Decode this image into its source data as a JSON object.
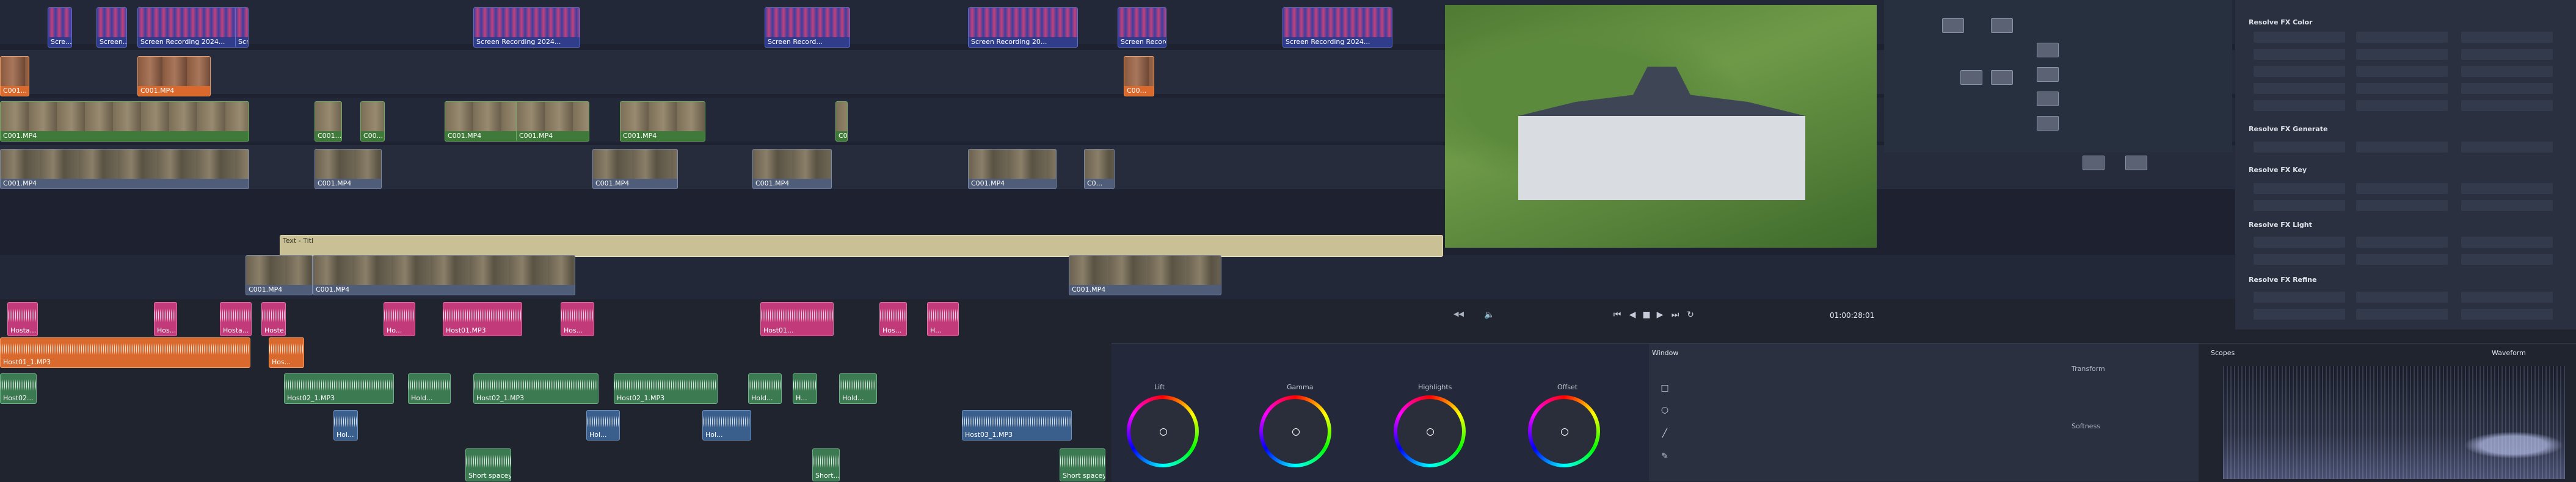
{
  "timeline": {
    "video_clips": [
      {
        "label": "Scre...",
        "kind": "blue-rec"
      },
      {
        "label": "Screen...",
        "kind": "blue-rec"
      },
      {
        "label": "Screen Recording 2024...",
        "kind": "blue-rec"
      },
      {
        "label": "Scr...",
        "kind": "blue-rec"
      },
      {
        "label": "Screen Recording 2024...",
        "kind": "blue-rec"
      },
      {
        "label": "Screen Record...",
        "kind": "blue-rec"
      },
      {
        "label": "Screen Recording 20...",
        "kind": "blue-rec"
      },
      {
        "label": "Screen Recordin...",
        "kind": "blue-rec"
      },
      {
        "label": "Screen Recording 2024...",
        "kind": "blue-rec"
      },
      {
        "label": "C001...",
        "kind": "orange"
      },
      {
        "label": "C001.MP4",
        "kind": "orange"
      },
      {
        "label": "C00...",
        "kind": "orange"
      },
      {
        "label": "C001.MP4",
        "kind": "green"
      },
      {
        "label": "C001...",
        "kind": "green"
      },
      {
        "label": "C00...",
        "kind": "green"
      },
      {
        "label": "C001.MP4",
        "kind": "green"
      },
      {
        "label": "C001.MP4",
        "kind": "green"
      },
      {
        "label": "C001.MP4",
        "kind": "green"
      },
      {
        "label": "C00...",
        "kind": "green"
      },
      {
        "label": "C001.MP4",
        "kind": "video"
      },
      {
        "label": "C001.MP4",
        "kind": "video"
      },
      {
        "label": "C001.MP4",
        "kind": "video"
      },
      {
        "label": "C001.MP4",
        "kind": "video"
      },
      {
        "label": "C001.MP4",
        "kind": "video"
      },
      {
        "label": "C0...",
        "kind": "video"
      },
      {
        "label": "Text - Titl",
        "kind": "title"
      },
      {
        "label": "C001.MP4",
        "kind": "video"
      },
      {
        "label": "C001.MP4",
        "kind": "video"
      },
      {
        "label": "C001.MP4",
        "kind": "video"
      }
    ],
    "audio_clips": [
      {
        "label": "Hosta...",
        "kind": "audio-pink"
      },
      {
        "label": "Hos...",
        "kind": "audio-pink"
      },
      {
        "label": "Hosta...",
        "kind": "audio-pink"
      },
      {
        "label": "Hoste...",
        "kind": "audio-pink"
      },
      {
        "label": "Ho...",
        "kind": "audio-pink"
      },
      {
        "label": "Host01.MP3",
        "kind": "audio-pink"
      },
      {
        "label": "Hos...",
        "kind": "audio-pink"
      },
      {
        "label": "Host01...",
        "kind": "audio-pink"
      },
      {
        "label": "Hos...",
        "kind": "audio-pink"
      },
      {
        "label": "H...",
        "kind": "audio-pink"
      },
      {
        "label": "Host01_1.MP3",
        "kind": "audio-orange"
      },
      {
        "label": "Hos...",
        "kind": "audio-orange"
      },
      {
        "label": "Host02...",
        "kind": "audio-green"
      },
      {
        "label": "Host02_1.MP3",
        "kind": "audio-green"
      },
      {
        "label": "Hold...",
        "kind": "audio-green"
      },
      {
        "label": "Host02_1.MP3",
        "kind": "audio-green"
      },
      {
        "label": "Host02_1.MP3",
        "kind": "audio-green"
      },
      {
        "label": "Hold...",
        "kind": "audio-green"
      },
      {
        "label": "H...",
        "kind": "audio-green"
      },
      {
        "label": "Hold...",
        "kind": "audio-green"
      },
      {
        "label": "Hol...",
        "kind": "audio-blue"
      },
      {
        "label": "Hol...",
        "kind": "audio-blue"
      },
      {
        "label": "Hol...",
        "kind": "audio-blue"
      },
      {
        "label": "Host03_1.MP3",
        "kind": "audio-blue"
      },
      {
        "label": "Short spacey",
        "kind": "audio-green"
      },
      {
        "label": "Short spacey",
        "kind": "audio-green"
      },
      {
        "label": "Short...",
        "kind": "audio-green"
      }
    ]
  },
  "viewer": {
    "timecode": "01:00:28:01"
  },
  "fx": {
    "headers": [
      "Resolve FX Color",
      "Resolve FX Generate",
      "Resolve FX Key",
      "Resolve FX Light",
      "Resolve FX Refine"
    ]
  },
  "color": {
    "wheels": [
      {
        "label": "Lift"
      },
      {
        "label": "Gamma"
      },
      {
        "label": "Highlights"
      },
      {
        "label": "Offset"
      }
    ],
    "window_label": "Window",
    "transform_label": "Transform",
    "softness_label": "Softness",
    "scopes_label": "Scopes",
    "waveform_label": "Waveform"
  },
  "colors": {
    "background": "#1e2230",
    "video": "#4f5d78",
    "green": "#3f7a3a",
    "orange": "#d9692c",
    "pink": "#c23a7a",
    "blue": "#3b5f8c",
    "title": "#c9c095"
  }
}
